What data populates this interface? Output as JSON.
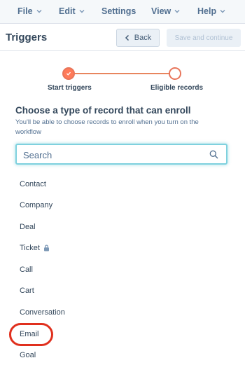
{
  "menubar": {
    "items": [
      {
        "label": "File",
        "has_dropdown": true
      },
      {
        "label": "Edit",
        "has_dropdown": true
      },
      {
        "label": "Settings",
        "has_dropdown": false
      },
      {
        "label": "View",
        "has_dropdown": true
      },
      {
        "label": "Help",
        "has_dropdown": true
      }
    ]
  },
  "header": {
    "title": "Triggers",
    "back_label": "Back",
    "save_label": "Save and continue"
  },
  "stepper": {
    "steps": [
      {
        "label": "Start triggers",
        "state": "complete"
      },
      {
        "label": "Eligible records",
        "state": "incomplete"
      }
    ]
  },
  "section": {
    "title": "Choose a type of record that can enroll",
    "description": "You'll be able to choose records to enroll when you turn on the workflow"
  },
  "search": {
    "value": "",
    "placeholder": "Search"
  },
  "record_types": [
    {
      "label": "Contact",
      "locked": false
    },
    {
      "label": "Company",
      "locked": false
    },
    {
      "label": "Deal",
      "locked": false
    },
    {
      "label": "Ticket",
      "locked": true
    },
    {
      "label": "Call",
      "locked": false
    },
    {
      "label": "Cart",
      "locked": false
    },
    {
      "label": "Conversation",
      "locked": false
    },
    {
      "label": "Email",
      "locked": false,
      "highlighted": true
    },
    {
      "label": "Goal",
      "locked": false
    }
  ],
  "colors": {
    "accent_orange": "#ff7a59",
    "focus_teal": "#7fd1de",
    "highlight_red": "#e0301e",
    "text_dark": "#33475b"
  }
}
